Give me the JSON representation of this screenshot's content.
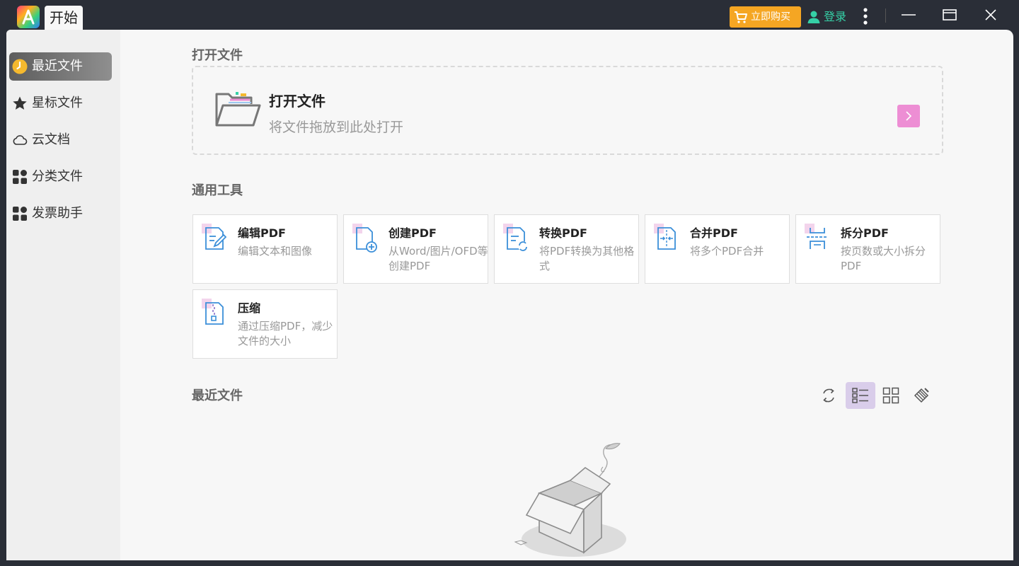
{
  "titlebar": {
    "tab_label": "开始",
    "buy_label": "立即购买",
    "login_label": "登录"
  },
  "sidebar": {
    "items": [
      {
        "label": "最近文件",
        "icon": "clock-icon",
        "active": true
      },
      {
        "label": "星标文件",
        "icon": "star-icon"
      },
      {
        "label": "云文档",
        "icon": "cloud-icon"
      },
      {
        "label": "分类文件",
        "icon": "category-icon"
      },
      {
        "label": "发票助手",
        "icon": "category-icon"
      }
    ]
  },
  "open_section": {
    "heading": "打开文件",
    "title": "打开文件",
    "subtitle": "将文件拖放到此处打开"
  },
  "tools_section": {
    "heading": "通用工具",
    "tools": [
      {
        "title": "编辑PDF",
        "desc": "编辑文本和图像",
        "icon": "edit-pdf-icon"
      },
      {
        "title": "创建PDF",
        "desc": "从Word/图片/OFD等创建PDF",
        "icon": "create-pdf-icon"
      },
      {
        "title": "转换PDF",
        "desc": "将PDF转换为其他格式",
        "icon": "convert-pdf-icon"
      },
      {
        "title": "合并PDF",
        "desc": "将多个PDF合并",
        "icon": "merge-pdf-icon"
      },
      {
        "title": "拆分PDF",
        "desc": "按页数或大小拆分PDF",
        "icon": "split-pdf-icon"
      },
      {
        "title": "压缩",
        "desc": "通过压缩PDF，减少文件的大小",
        "icon": "compress-icon"
      }
    ]
  },
  "recent_section": {
    "heading": "最近文件",
    "view_buttons": [
      "refresh-icon",
      "list-view-icon",
      "grid-view-icon",
      "clear-icon"
    ],
    "active_view": "list-view-icon"
  },
  "colors": {
    "accent_pink": "#ed8ed4",
    "buy_orange": "#f5a623",
    "login_green": "#35d0a6",
    "icon_blue": "#3b8fd9"
  }
}
